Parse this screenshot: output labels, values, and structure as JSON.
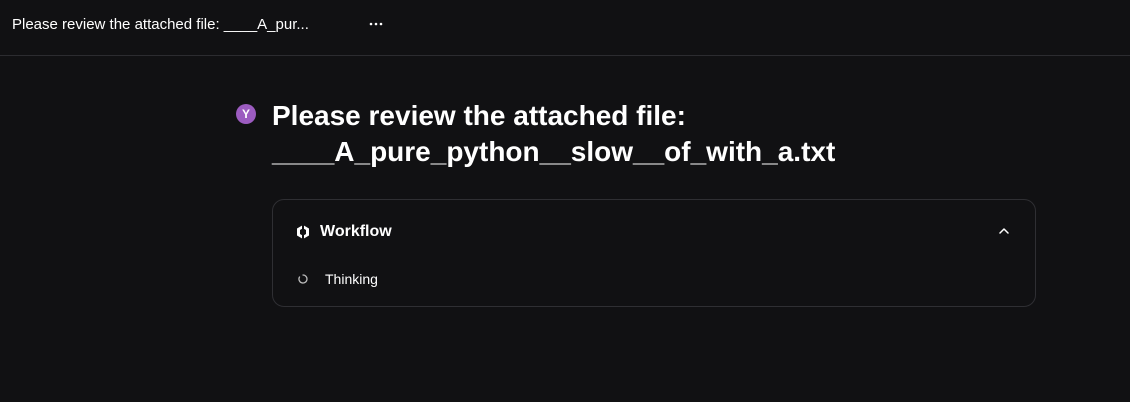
{
  "header": {
    "title": "Please review the attached file: ____A_pur...",
    "more_icon": "more-horizontal-icon"
  },
  "message": {
    "avatar_letter": "Y",
    "avatar_color": "#9c5cc0",
    "title_line1": "Please review the attached file:",
    "title_line2": "____A_pure_python__slow__of_with_a.txt"
  },
  "workflow": {
    "label": "Workflow",
    "icon": "workflow-icon",
    "collapse_icon": "chevron-up-icon",
    "status": {
      "label": "Thinking",
      "icon": "spinner-icon"
    }
  },
  "colors": {
    "background": "#111113",
    "border": "#2f2f33",
    "text": "#ffffff"
  }
}
